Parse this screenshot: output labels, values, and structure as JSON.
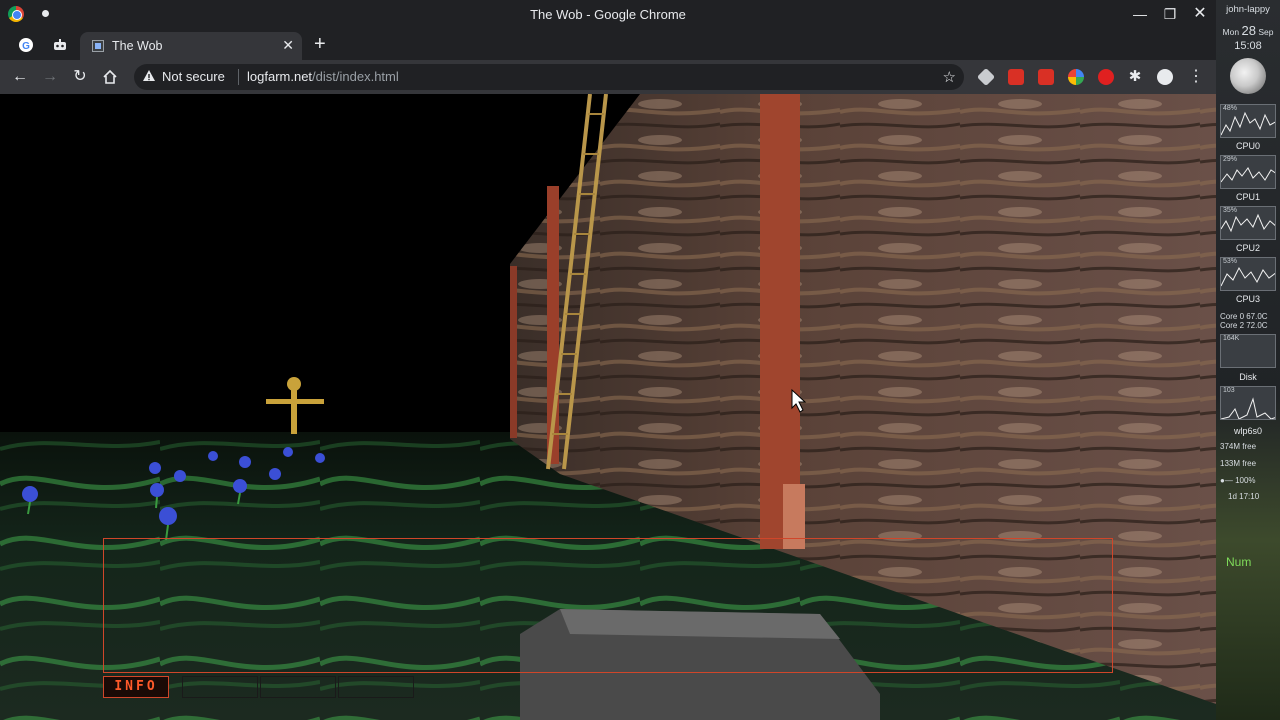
{
  "window": {
    "title": "The Wob - Google Chrome"
  },
  "tabs": {
    "active_label": "The Wob"
  },
  "address_bar": {
    "security_label": "Not secure",
    "host": "logfarm.net",
    "path": "/dist/index.html"
  },
  "game": {
    "hud_tab_label": "INFO"
  },
  "panel": {
    "user": "john-lappy",
    "date_prefix": "Mon",
    "day": "28",
    "month": "Sep",
    "time": "15:08",
    "graphs": [
      {
        "caption": "48%",
        "label": "CPU0"
      },
      {
        "caption": "29%",
        "label": "CPU1"
      },
      {
        "caption": "35%",
        "label": "CPU2"
      },
      {
        "caption": "53%",
        "label": "CPU3"
      }
    ],
    "core0": "Core 0 67.0C",
    "core2": "Core 2 72.0C",
    "disk_caption": "164K",
    "disk_label": "Disk",
    "net_caption": "103",
    "net_label": "wlp6s0",
    "mem1": "374M free",
    "mem2": "133M free",
    "battery": "100%",
    "uptime": "1d 17:10",
    "num_label": "Num"
  },
  "colors": {
    "hud_border": "#d0462a",
    "hud_text": "#ff5a2a",
    "chrome_dark": "#202124",
    "chrome_toolbar": "#35363a"
  }
}
